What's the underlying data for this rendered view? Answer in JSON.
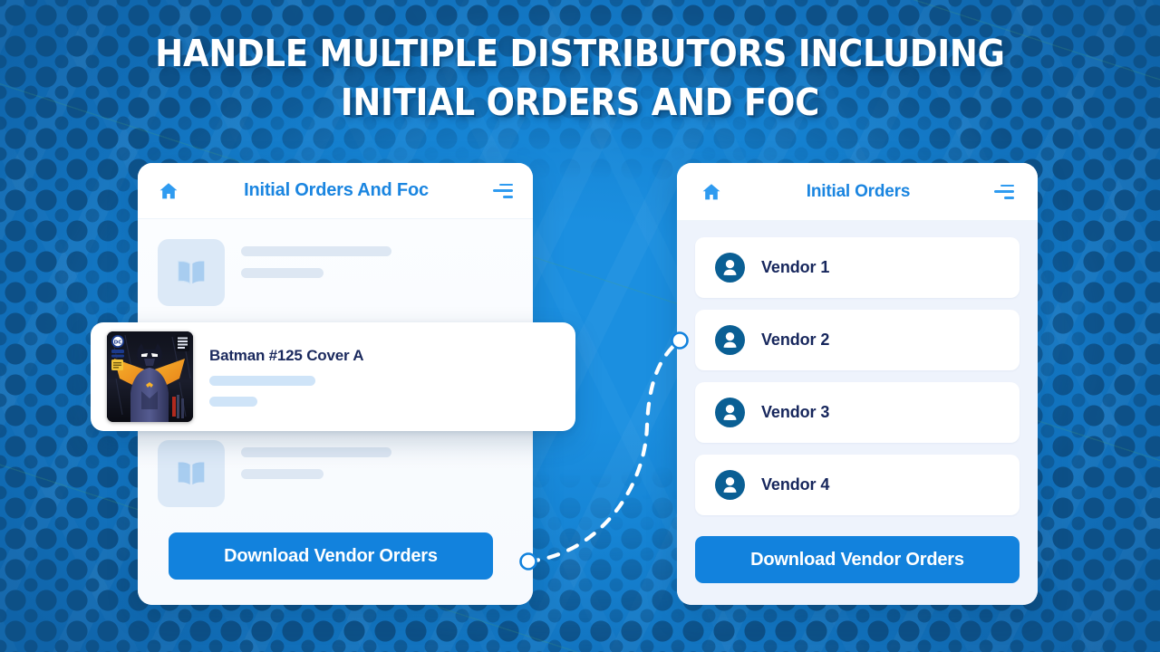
{
  "headline": {
    "line1": "Handle Multiple Distributors Including",
    "line2": "Initial Orders And Foc"
  },
  "colors": {
    "background_blue": "#1179ca",
    "background_dot": "#0d4f85",
    "accent_blue": "#1282dd",
    "title_blue": "#1a85e0",
    "navy_text": "#16265c",
    "avatar_teal": "#0a5f94",
    "panel_bg": "#eef3fc",
    "skeleton_gray": "#dde7f3",
    "book_tile": "#dce9f7"
  },
  "left_panel": {
    "home_icon": "home-icon",
    "title": "Initial Orders And Foc",
    "menu_icon": "hamburger-icon",
    "list_items": [
      {
        "thumb_icon": "open-book-icon",
        "placeholder": true
      },
      {
        "thumb_icon": "open-book-icon",
        "placeholder": true
      }
    ],
    "download_button": "Download Vendor Orders"
  },
  "featured_card": {
    "cover_icon": "batman-comic-cover",
    "title": "Batman #125 Cover A",
    "cover_labels": {
      "publisher": "DC",
      "corner_text": "BATMAN"
    }
  },
  "right_panel": {
    "home_icon": "home-icon",
    "title": "Initial Orders",
    "menu_icon": "hamburger-icon",
    "vendors": [
      {
        "avatar_icon": "person-icon",
        "name": "Vendor 1"
      },
      {
        "avatar_icon": "person-icon",
        "name": "Vendor 2"
      },
      {
        "avatar_icon": "person-icon",
        "name": "Vendor 3"
      },
      {
        "avatar_icon": "person-icon",
        "name": "Vendor 4"
      }
    ],
    "download_button": "Download Vendor Orders"
  },
  "connector": {
    "icon": "dashed-curve-connector",
    "start_node": "connector-node-start",
    "end_node": "connector-node-end"
  }
}
